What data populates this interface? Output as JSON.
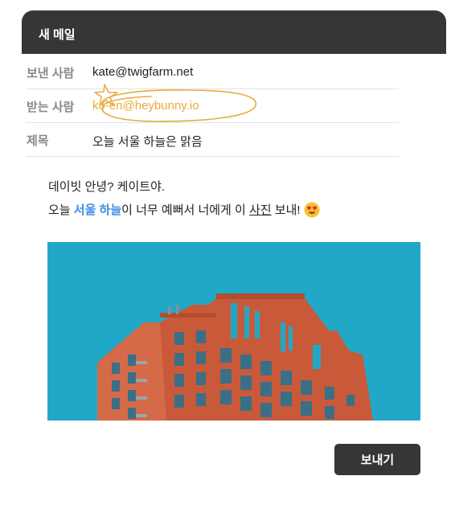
{
  "window": {
    "title": "새 메일"
  },
  "fields": [
    {
      "label": "보낸 사람",
      "value": "kate@twigfarm.net"
    },
    {
      "label": "받는 사람",
      "value": "ko-en@heybunny.io"
    },
    {
      "label": "제목",
      "value": "오늘 서울 하늘은 맑음"
    }
  ],
  "message": {
    "line1": "데이빗 안녕? 케이트야.",
    "line2_prefix": "오늘 ",
    "line2_highlight": "서울 하늘",
    "line2_mid": "이 너무 예뻐서 너에게 이 ",
    "line2_underline": "사진",
    "line2_suffix": " 보내!",
    "emoji": "heart-eyes-emoji"
  },
  "attachment": {
    "icon": "building-photo"
  },
  "actions": {
    "send_label": "보내기"
  },
  "colors": {
    "titlebar": "#363636",
    "accent_yellow": "#e6ac3a",
    "highlight_blue": "#3a8ee6",
    "sky": "#21a8c7",
    "building": "#c85a3a"
  }
}
